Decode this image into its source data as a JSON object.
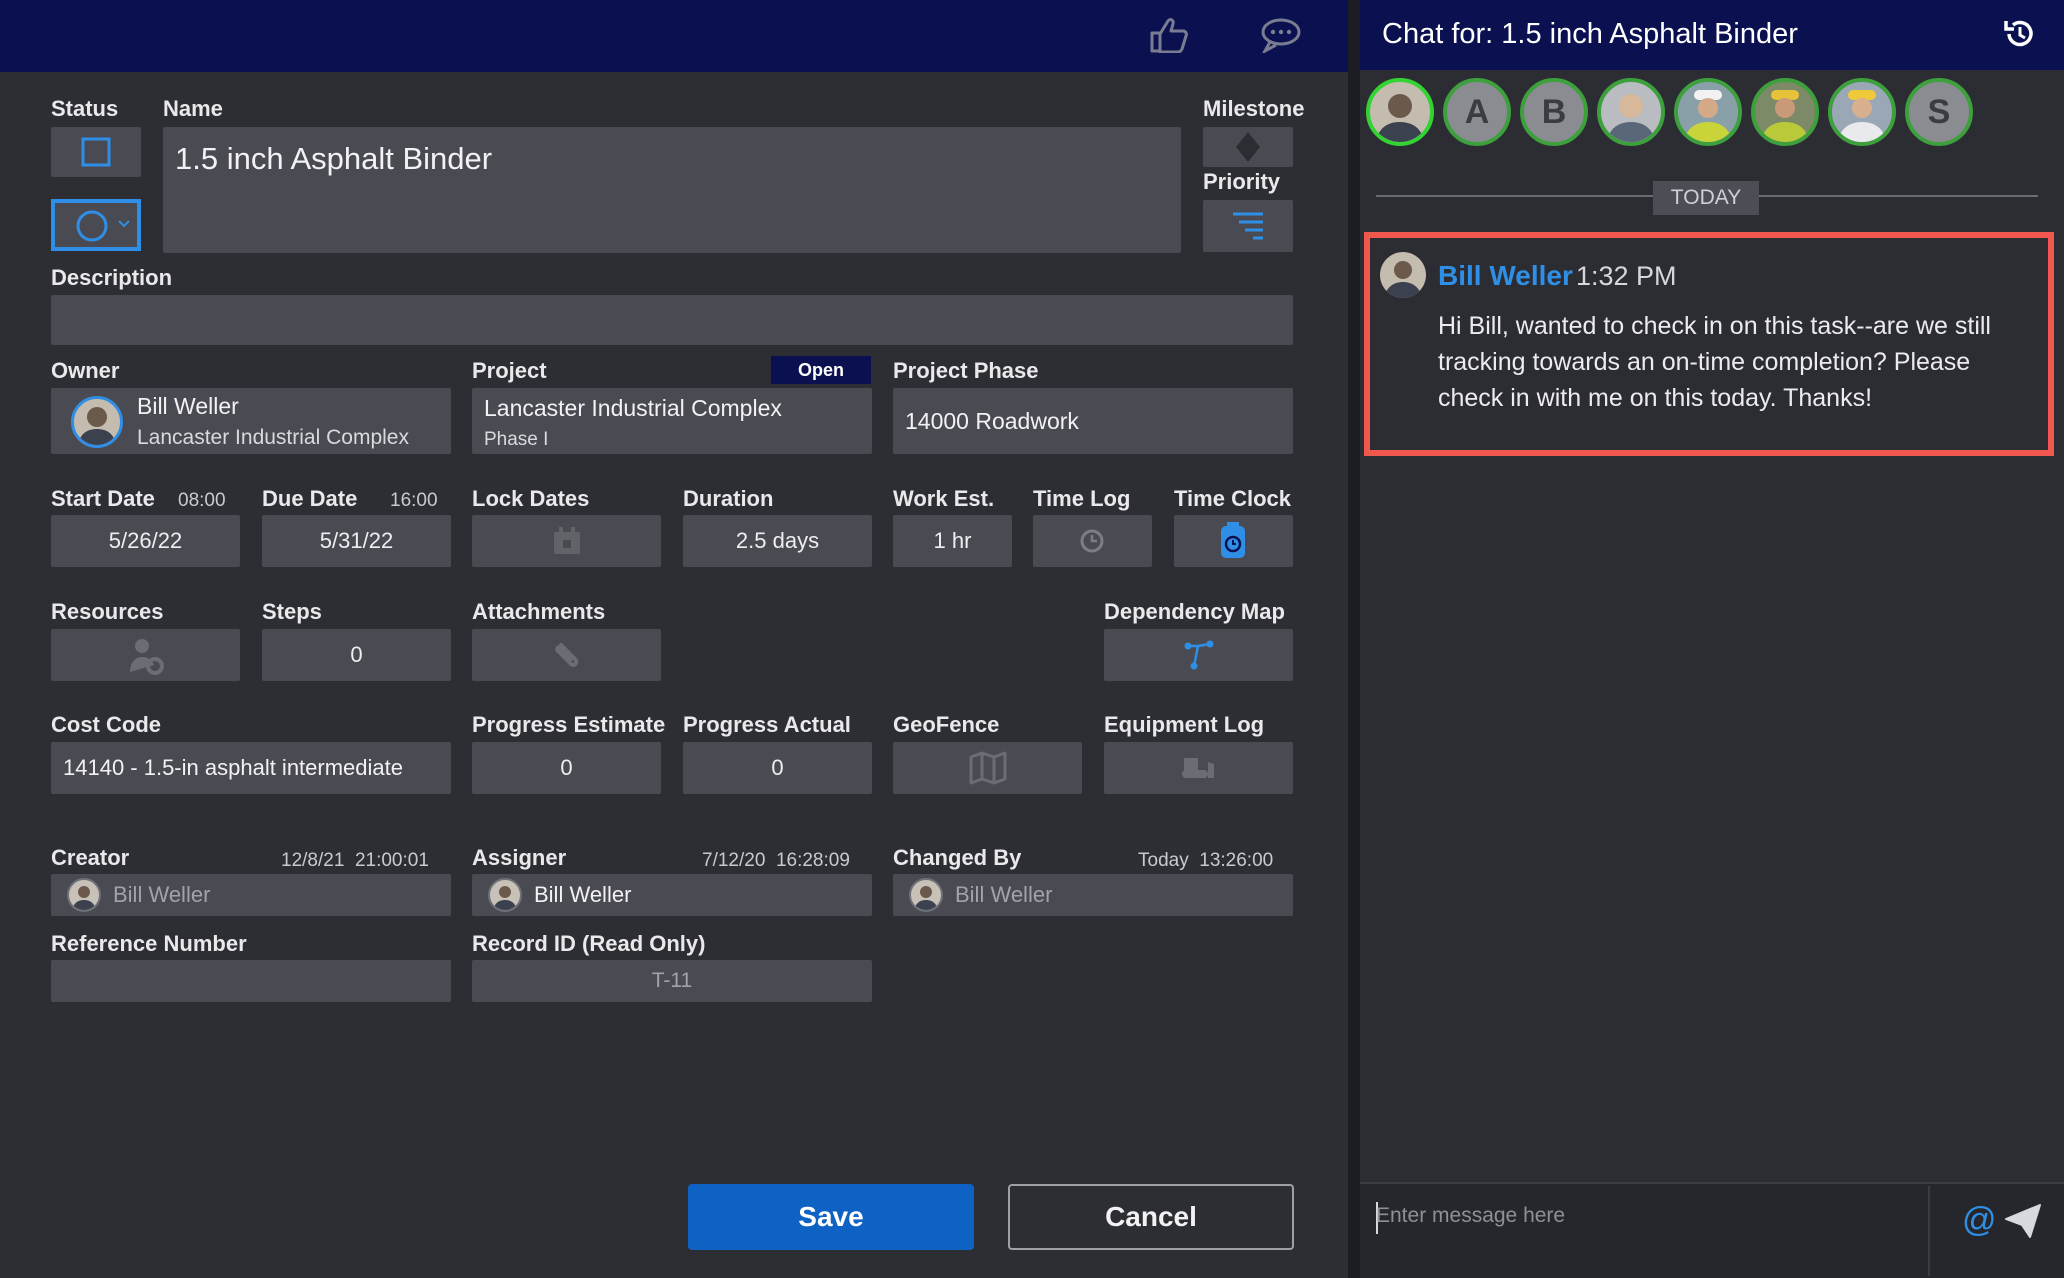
{
  "form": {
    "status_label": "Status",
    "name_label": "Name",
    "name_value": "1.5 inch Asphalt Binder",
    "milestone_label": "Milestone",
    "priority_label": "Priority",
    "description_label": "Description",
    "description_value": "",
    "owner": {
      "label": "Owner",
      "name": "Bill Weller",
      "org": "Lancaster Industrial Complex"
    },
    "project": {
      "label": "Project",
      "badge": "Open",
      "name": "Lancaster Industrial Complex",
      "phase": "Phase I"
    },
    "project_phase": {
      "label": "Project Phase",
      "value": "14000 Roadwork"
    },
    "start_date": {
      "label": "Start Date",
      "time": "08:00",
      "value": "5/26/22"
    },
    "due_date": {
      "label": "Due Date",
      "time": "16:00",
      "value": "5/31/22"
    },
    "lock_dates_label": "Lock Dates",
    "duration": {
      "label": "Duration",
      "value": "2.5 days"
    },
    "work_est": {
      "label": "Work Est.",
      "value": "1 hr"
    },
    "time_log_label": "Time Log",
    "time_clock_label": "Time Clock",
    "resources_label": "Resources",
    "steps": {
      "label": "Steps",
      "value": "0"
    },
    "attachments_label": "Attachments",
    "dependency_map_label": "Dependency Map",
    "cost_code": {
      "label": "Cost Code",
      "value": "14140 - 1.5-in asphalt intermediate"
    },
    "progress_estimate": {
      "label": "Progress Estimate",
      "value": "0"
    },
    "progress_actual": {
      "label": "Progress Actual",
      "value": "0"
    },
    "geofence_label": "GeoFence",
    "equipment_log_label": "Equipment Log",
    "creator": {
      "label": "Creator",
      "time": "12/8/21  21:00:01",
      "name": "Bill Weller"
    },
    "assigner": {
      "label": "Assigner",
      "time": "7/12/20  16:28:09",
      "name": "Bill Weller"
    },
    "changed_by": {
      "label": "Changed By",
      "time": "Today  13:26:00",
      "name": "Bill Weller"
    },
    "reference_number": {
      "label": "Reference Number",
      "value": ""
    },
    "record_id": {
      "label": "Record ID (Read Only)",
      "value": "T-11"
    },
    "save_label": "Save",
    "cancel_label": "Cancel"
  },
  "chat": {
    "title": "Chat for: 1.5 inch Asphalt Binder",
    "participants": [
      "",
      "A",
      "B",
      "",
      "",
      "",
      "",
      "S"
    ],
    "date_divider": "TODAY",
    "message": {
      "author": "Bill Weller",
      "time": "1:32 PM",
      "text": "Hi Bill, wanted to check in on this task--are we still tracking towards an on-time completion? Please check in with me on this today. Thanks!"
    },
    "input_placeholder": "Enter message here"
  },
  "colors": {
    "accent_blue": "#2f8fe6",
    "save_button": "#0d62c4",
    "highlight_border": "#f0574e",
    "avatar_ring": "#3da03d",
    "header_navy": "#0b1150"
  },
  "icons": {
    "thumbs_up": "thumbs-up-icon",
    "comment": "comment-icon",
    "history": "history-icon",
    "send": "send-icon",
    "mention": "at-icon"
  }
}
